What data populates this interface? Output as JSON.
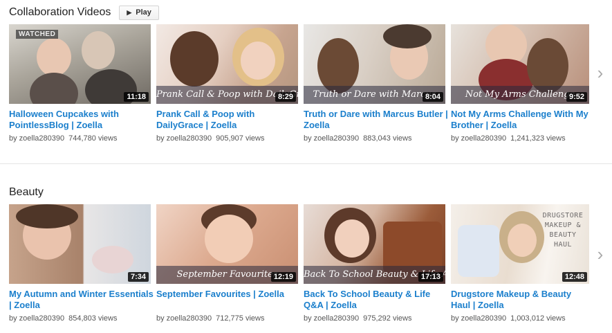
{
  "sections": [
    {
      "title": "Collaboration Videos",
      "play_label": "Play",
      "videos": [
        {
          "title": "Halloween Cupcakes with PointlessBlog | Zoella",
          "duration": "11:18",
          "badge": "WATCHED",
          "caption": "",
          "by": "by zoella280390",
          "views": "744,780 views"
        },
        {
          "title": "Prank Call & Poop with DailyGrace | Zoella",
          "duration": "8:29",
          "caption": "Prank Call & Poop with DailyGrace",
          "by": "by zoella280390",
          "views": "905,907 views"
        },
        {
          "title": "Truth or Dare with Marcus Butler | Zoella",
          "duration": "8:04",
          "caption": "Truth or Dare with Marcus",
          "by": "by zoella280390",
          "views": "883,043 views"
        },
        {
          "title": "Not My Arms Challenge With My Brother | Zoella",
          "duration": "9:52",
          "caption": "Not My Arms Challenge",
          "by": "by zoella280390",
          "views": "1,241,323 views"
        }
      ]
    },
    {
      "title": "Beauty",
      "videos": [
        {
          "title": "My Autumn and Winter Essentials | Zoella",
          "duration": "7:34",
          "caption": "",
          "by": "by zoella280390",
          "views": "854,803 views"
        },
        {
          "title": "September Favourites | Zoella",
          "duration": "12:19",
          "caption": "September Favourites",
          "by": "by zoella280390",
          "views": "712,775 views"
        },
        {
          "title": "Back To School Beauty & Life Q&A | Zoella",
          "duration": "17:13",
          "caption": "Back To School Beauty & Life Ad",
          "by": "by zoella280390",
          "views": "975,292 views"
        },
        {
          "title": "Drugstore Makeup & Beauty Haul | Zoella",
          "duration": "12:48",
          "caption": "",
          "thumb_text": "DRUGSTORE MAKEUP & BEAUTY HAUL",
          "by": "by zoella280390",
          "views": "1,003,012 views"
        }
      ]
    }
  ],
  "icons": {
    "next": "chevron-right-icon",
    "play": "play-icon"
  },
  "colors": {
    "link": "#1b7fcc",
    "meta": "#555555"
  }
}
